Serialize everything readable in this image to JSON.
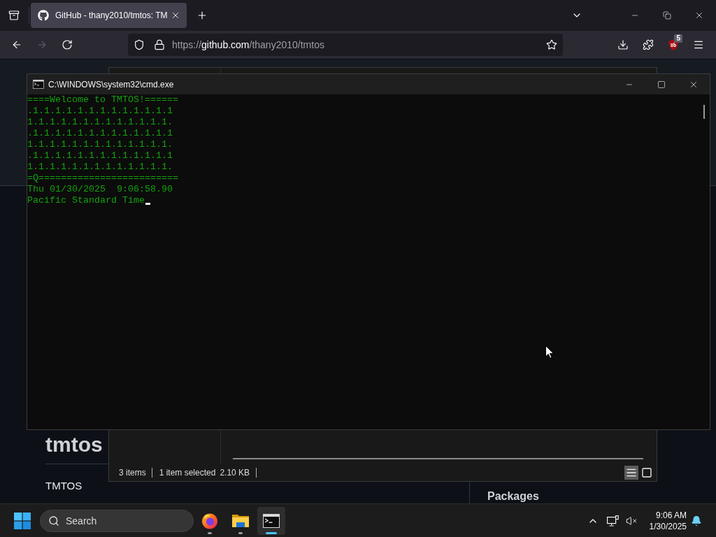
{
  "browser": {
    "tabs": [
      {
        "title": "GitHub - thany2010/tmtos: TM",
        "selected": true
      }
    ],
    "address": {
      "scheme": "https://",
      "host": "github.com",
      "path": "/thany2010/tmtos"
    },
    "forward_disabled": true,
    "extension_badge": "5"
  },
  "page": {
    "repo_title": "tmtos",
    "about_title": "TMTOS",
    "packages_heading": "Packages"
  },
  "explorer": {
    "status": {
      "items": "3 items",
      "selected": "1 item selected",
      "size": "2.10 KB"
    },
    "views": [
      {
        "kind": "details",
        "selected": true
      },
      {
        "kind": "large_icons",
        "selected": false
      }
    ]
  },
  "console": {
    "title": "C:\\WINDOWS\\system32\\cmd.exe",
    "lines": [
      "====Welcome to TMTOS!======",
      ".1.1.1.1.1.1.1.1.1.1.1.1.1",
      "1.1.1.1.1.1.1.1.1.1.1.1.1.",
      ".1.1.1.1.1.1.1.1.1.1.1.1.1",
      "1.1.1.1.1.1.1.1.1.1.1.1.1.",
      ".1.1.1.1.1.1.1.1.1.1.1.1.1",
      "1.1.1.1.1.1.1.1.1.1.1.1.1.",
      "=Q=========================",
      "Thu 01/30/2025  9:06:58.90",
      "Pacific Standard Time"
    ],
    "cursor": true
  },
  "taskbar": {
    "search_placeholder": "Search",
    "apps": [
      {
        "kind": "browser",
        "selected": false
      },
      {
        "kind": "folder",
        "selected": false
      },
      {
        "kind": "terminal",
        "selected": true
      }
    ],
    "clock": {
      "time": "9:06 AM",
      "date": "1/30/2025"
    }
  }
}
